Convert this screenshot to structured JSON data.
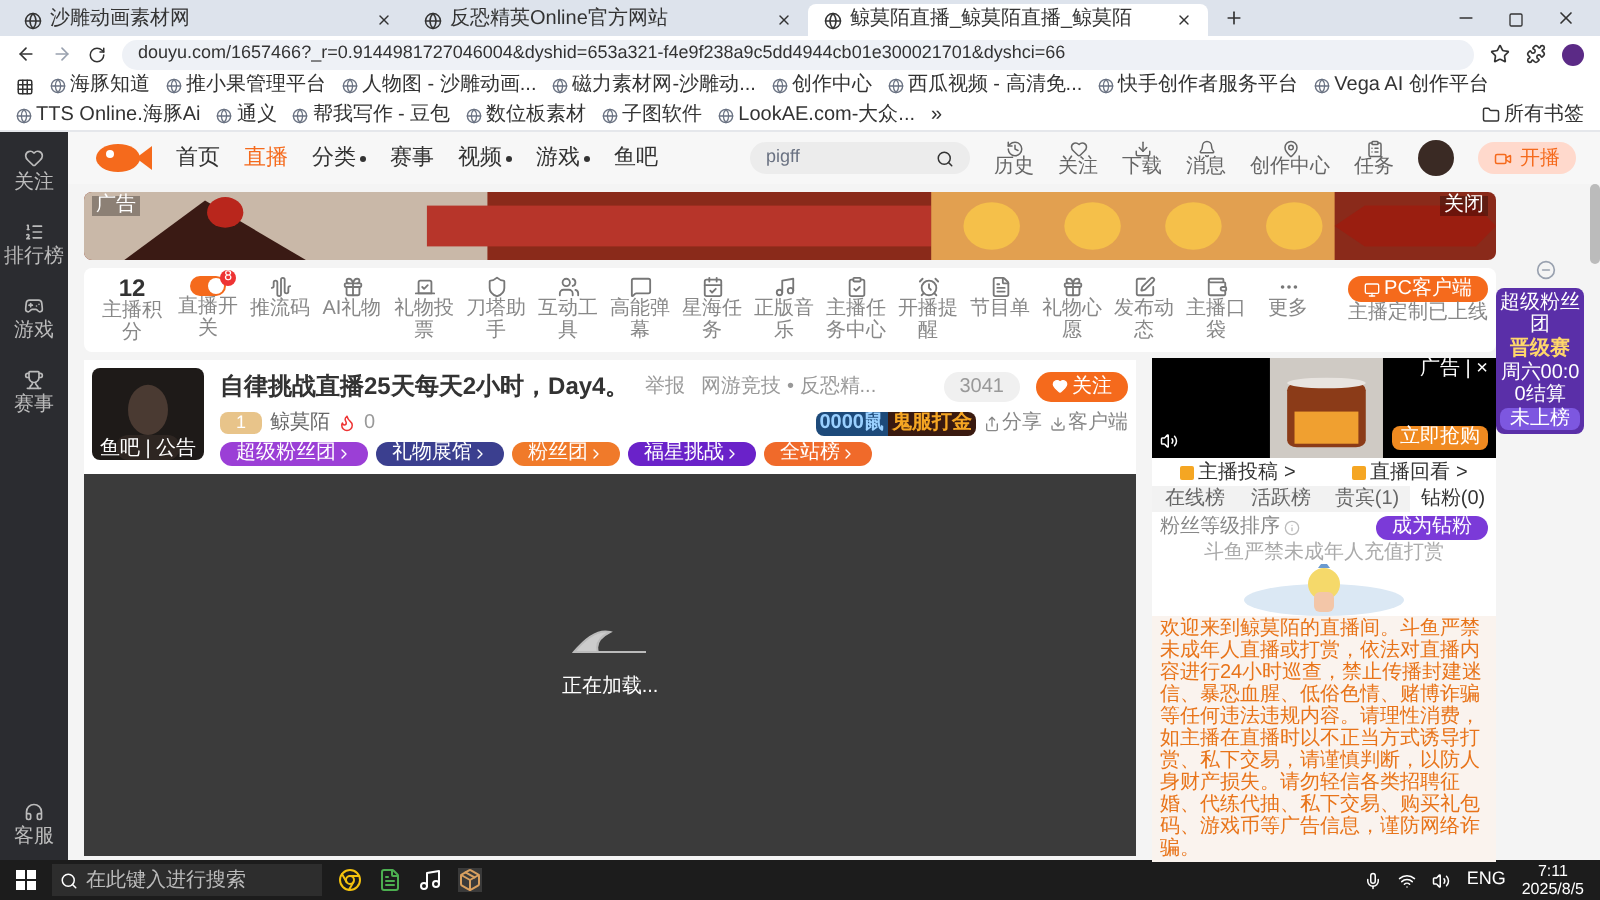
{
  "browser": {
    "tabs": [
      {
        "title": "沙雕动画素材网",
        "selected": false
      },
      {
        "title": "反恐精英Online官方网站",
        "selected": false
      },
      {
        "title": "鲸莫陌直播_鲸莫陌直播_鲸莫陌",
        "selected": true
      }
    ],
    "url": "douyu.com/1657466?_r=0.9144981727046004&dyshid=653a321-f4e9f238a9c5dd4944cb01e300021701&dyshci=66",
    "bookmarks": [
      "海豚知道",
      "推小果管理平台",
      "人物图 - 沙雕动画...",
      "磁力素材网-沙雕动...",
      "创作中心",
      "西瓜视频 - 高清免...",
      "快手创作者服务平台",
      "Vega AI 创作平台",
      "TTS Online.海豚Ai",
      "通义",
      "帮我写作 - 豆包",
      "数位板素材",
      "子图软件",
      "LookAE.com-大众..."
    ],
    "more": "»",
    "all_bookmarks": "所有书签"
  },
  "site_header": {
    "nav": [
      {
        "label": "首页",
        "selected": false,
        "has_menu": false
      },
      {
        "label": "直播",
        "selected": true,
        "has_menu": false
      },
      {
        "label": "分类",
        "selected": false,
        "has_menu": true
      },
      {
        "label": "赛事",
        "selected": false,
        "has_menu": false
      },
      {
        "label": "视频",
        "selected": false,
        "has_menu": true
      },
      {
        "label": "游戏",
        "selected": false,
        "has_menu": true
      },
      {
        "label": "鱼吧",
        "selected": false,
        "has_menu": false
      }
    ],
    "search": {
      "value": "pigff"
    },
    "tools": [
      "历史",
      "关注",
      "下载",
      "消息",
      "创作中心",
      "任务"
    ],
    "start_button": "开播"
  },
  "sidebar": {
    "items": [
      "关注",
      "排行榜",
      "游戏",
      "赛事"
    ],
    "service": "客服"
  },
  "banner": {
    "ad_label": "广告",
    "close": "关闭"
  },
  "toolbar": {
    "score": "12",
    "score_label": "主播积分",
    "items": [
      {
        "kind": "toggle",
        "label": "直播开关",
        "on": true,
        "badge": "8"
      },
      {
        "kind": "icon",
        "label": "推流码"
      },
      {
        "kind": "icon",
        "label": "AI礼物"
      },
      {
        "kind": "icon",
        "label": "礼物投票"
      },
      {
        "kind": "icon",
        "label": "刀塔助手"
      },
      {
        "kind": "icon",
        "label": "互动工具"
      },
      {
        "kind": "icon",
        "label": "高能弹幕"
      },
      {
        "kind": "icon",
        "label": "星海任务"
      },
      {
        "kind": "icon",
        "label": "正版音乐"
      },
      {
        "kind": "icon",
        "label": "主播任务中心"
      },
      {
        "kind": "icon",
        "label": "开播提醒"
      },
      {
        "kind": "icon",
        "label": "节目单"
      },
      {
        "kind": "icon",
        "label": "礼物心愿"
      },
      {
        "kind": "icon",
        "label": "发布动态"
      },
      {
        "kind": "icon",
        "label": "主播口袋"
      },
      {
        "kind": "icon",
        "label": "更多"
      }
    ],
    "pc_button": "PC客户端",
    "pc_note": "主播定制已上线"
  },
  "stream": {
    "title": "自律挑战直播25天每天2小时，Day4。",
    "report": "举报",
    "category": "网游竞技 • 反恐精...",
    "avatar_caption": "鱼吧 | 公告",
    "level": "1",
    "host": "鲸莫陌",
    "heat": "0",
    "tags": [
      {
        "label": "超级粉丝团",
        "color": "#9b3fd6"
      },
      {
        "label": "礼物展馆",
        "color": "#3b3f8f"
      },
      {
        "label": "粉丝团",
        "color": "#f07a2a"
      },
      {
        "label": "福星挑战",
        "color": "#6a22c9"
      },
      {
        "label": "全站榜",
        "color": "#f06a2a"
      }
    ],
    "followers": "3041",
    "follow": "关注",
    "promo": [
      "0000鼠",
      "鬼服打金"
    ],
    "share": "分享",
    "client": "客户端"
  },
  "player": {
    "status": "正在加载..."
  },
  "side": {
    "ad": {
      "label": "广告 | ×",
      "cta": "立即抢购"
    },
    "links": [
      "主播投稿 >",
      "直播回看 >"
    ],
    "tabs": [
      {
        "label": "在线榜",
        "selected": false
      },
      {
        "label": "活跃榜",
        "selected": false
      },
      {
        "label": "贵宾(1)",
        "selected": false
      },
      {
        "label": "钻粉(0)",
        "selected": true
      }
    ],
    "sort_label": "粉丝等级排序",
    "join": "成为钻粉",
    "warning": "斗鱼严禁未成年人充值打赏",
    "notice": "欢迎来到鲸莫陌的直播间。斗鱼严禁未成年人直播或打赏，依法对直播内容进行24小时巡查，禁止传播封建迷信、暴恐血腥、低俗色情、赌博诈骗等任何违法违规内容。请理性消费，如主播在直播时以不正当方式诱导打赏、私下交易，请谨慎判断，以防人身财产损失。请勿轻信各类招聘征婚、代练代抽、私下交易、购买礼包码、游戏币等广告信息，谨防网络诈骗。"
  },
  "fan_card": {
    "title": "超级粉丝团",
    "event": "晋级赛",
    "time": "周六00:00结算",
    "status": "未上榜"
  },
  "taskbar": {
    "search_placeholder": "在此键入进行搜索",
    "lang": "ENG",
    "time": "7:11",
    "date": "2025/8/5"
  }
}
